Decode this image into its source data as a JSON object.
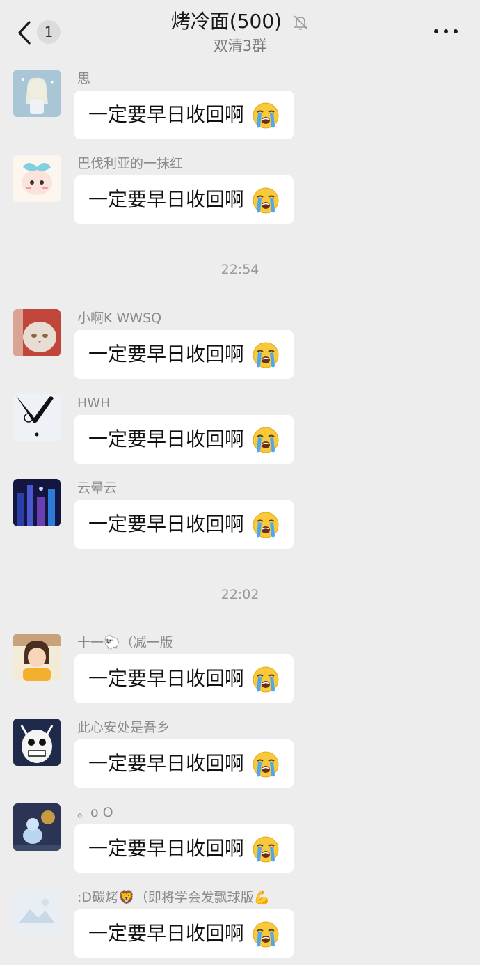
{
  "header": {
    "title": "烤冷面(500)",
    "subtitle": "双清3群",
    "unread_count": "1",
    "back_icon": "chevron-left-icon",
    "mute_icon": "bell-off-icon",
    "more_icon": "more-horizontal-icon"
  },
  "timestamps": [
    "22:54",
    "22:02"
  ],
  "messages": [
    {
      "nickname": "思",
      "text": "一定要早日收回啊",
      "emoji": "loudly-crying-face"
    },
    {
      "nickname": "巴伐利亚的一抹红",
      "text": "一定要早日收回啊",
      "emoji": "loudly-crying-face"
    },
    {
      "nickname": "小啊K WWSQ",
      "text": "一定要早日收回啊",
      "emoji": "loudly-crying-face"
    },
    {
      "nickname": "HWH",
      "text": "一定要早日收回啊",
      "emoji": "loudly-crying-face"
    },
    {
      "nickname": "云晕云",
      "text": "一定要早日收回啊",
      "emoji": "loudly-crying-face"
    },
    {
      "nickname": "十一🐑（减一版",
      "text": "一定要早日收回啊",
      "emoji": "loudly-crying-face"
    },
    {
      "nickname": "此心安处是吾乡",
      "text": "一定要早日收回啊",
      "emoji": "loudly-crying-face"
    },
    {
      "nickname": "。o O",
      "text": "一定要早日收回啊",
      "emoji": "loudly-crying-face"
    },
    {
      "nickname": ":D碳烤🦁（即将学会发飘球版💪",
      "text": "一定要早日收回啊",
      "emoji": "loudly-crying-face"
    }
  ],
  "colors": {
    "background": "#ededed",
    "bubble": "#ffffff",
    "nickname": "#8a8a8a",
    "timestamp": "#9a9a9a"
  }
}
